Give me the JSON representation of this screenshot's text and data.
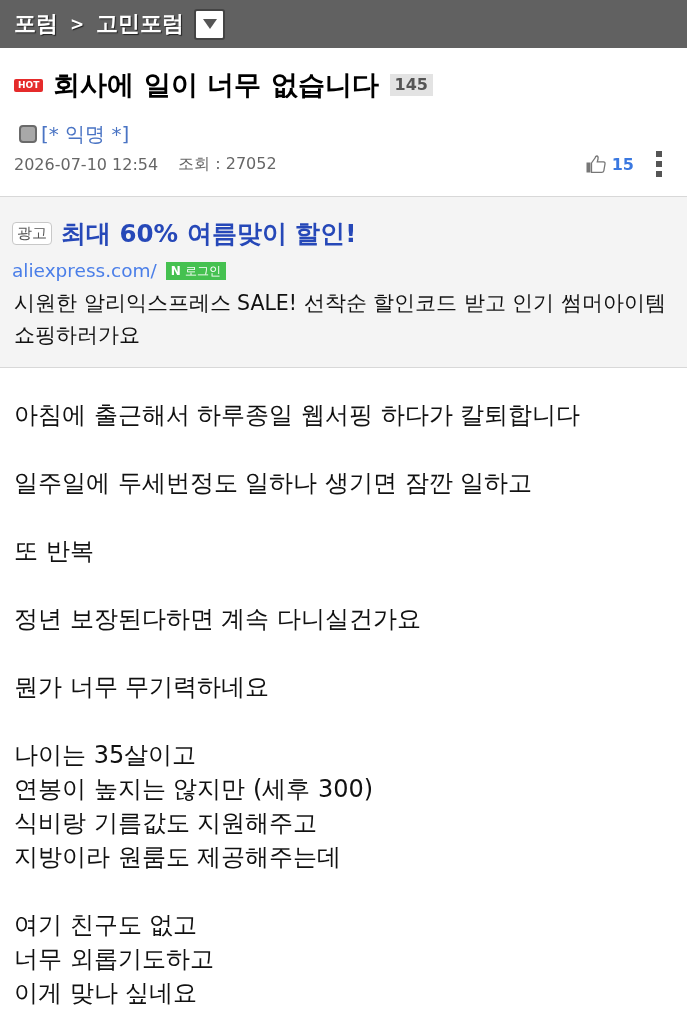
{
  "breadcrumb": {
    "items": [
      "포럼",
      "고민포럼"
    ],
    "separator": ">"
  },
  "post": {
    "hot_badge": "HOT",
    "title": "회사에 일이 너무 없습니다",
    "comment_count": "145",
    "author": "[* 익명 *]",
    "date": "2026-07-10 12:54",
    "views": "조회 : 27052",
    "likes": "15"
  },
  "ad": {
    "label": "광고",
    "title": "최대 60% 여름맞이 할인!",
    "url": "aliexpress.com/",
    "login_badge": "**N** 로그인",
    "description": "시원한 알리익스프레스 SALE! 선착순 할인코드 받고 인기 썸머아이템 쇼핑하러가요"
  },
  "body": {
    "paragraphs": [
      [
        "아침에 출근해서 하루종일 웹서핑 하다가 칼퇴합니다"
      ],
      [
        "일주일에 두세번정도 일하나 생기면 잠깐 일하고"
      ],
      [
        "또 반복"
      ],
      [
        "정년 보장된다하면 계속 다니실건가요"
      ],
      [
        "뭔가 너무 무기력하네요"
      ],
      [
        "나이는 35살이고",
        "연봉이 높지는 않지만 (세후 300)",
        "식비랑 기름값도 지원해주고",
        "지방이라 원룸도 제공해주는데"
      ],
      [
        "여기 친구도 없고",
        "너무 외롭기도하고",
        "이게 맞나 싶네요"
      ]
    ]
  }
}
